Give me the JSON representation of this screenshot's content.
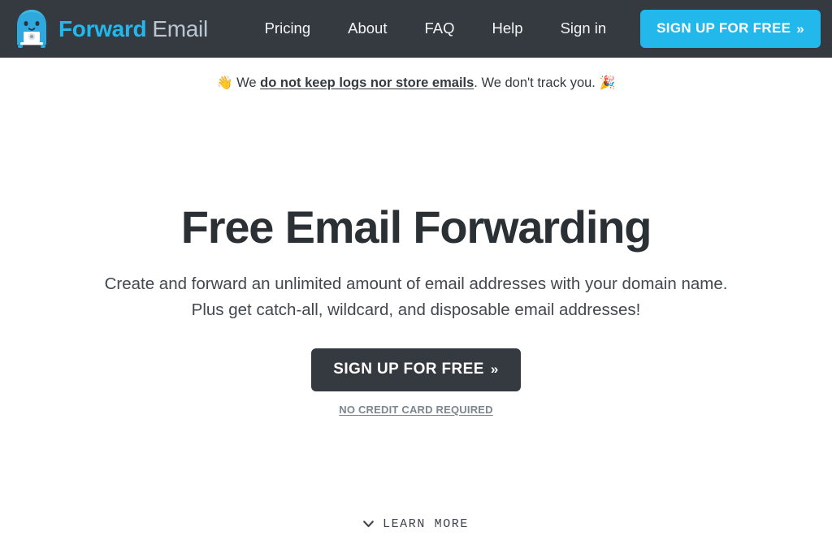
{
  "header": {
    "logo": {
      "icon": "mascot-logo-icon",
      "word_primary": "Forward",
      "word_secondary": "Email",
      "color_primary": "#22b8eb",
      "color_secondary": "#b9c6d1"
    },
    "background_color": "#343a40",
    "nav": [
      {
        "label": "Pricing"
      },
      {
        "label": "About"
      },
      {
        "label": "FAQ"
      },
      {
        "label": "Help"
      },
      {
        "label": "Sign in"
      }
    ],
    "cta": {
      "label": "SIGN UP FOR FREE",
      "chevron": "»",
      "color": "#22b8eb"
    }
  },
  "banner": {
    "emoji_left": "👋",
    "text_before": "We ",
    "emphasis": "do not keep logs nor store emails",
    "text_after": ". We don't track you. ",
    "emoji_right": "🎉"
  },
  "hero": {
    "title": "Free Email Forwarding",
    "subtitle_line1": "Create and forward an unlimited amount of email addresses with your domain name.",
    "subtitle_line2": "Plus get catch-all, wildcard, and disposable email addresses!",
    "cta": {
      "label": "SIGN UP FOR FREE",
      "chevron": "»",
      "color": "#343a40"
    },
    "no_credit_card": "NO CREDIT CARD REQUIRED"
  },
  "footer": {
    "learn_more": "LEARN MORE",
    "caret_icon": "chevron-down-icon"
  }
}
